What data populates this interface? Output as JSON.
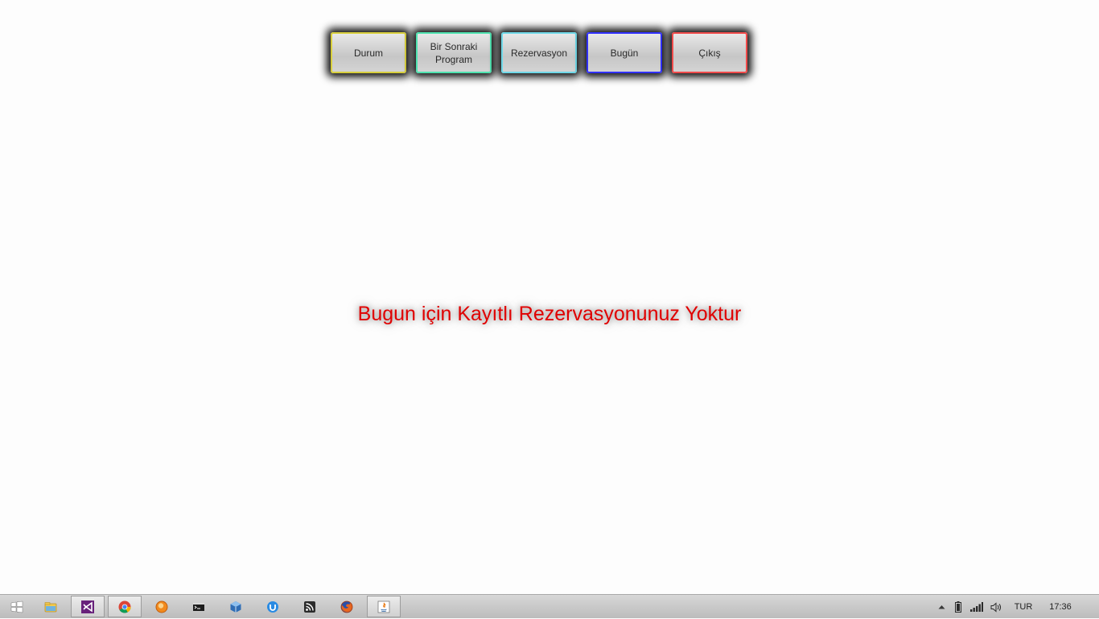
{
  "nav": {
    "buttons": [
      {
        "id": "durum",
        "label": "Durum",
        "border_color": "#d8cf3c"
      },
      {
        "id": "bir-sonraki-program",
        "label": "Bir Sonraki\nProgram",
        "border_color": "#4fe3b0"
      },
      {
        "id": "rezervasyon",
        "label": "Rezervasyon",
        "border_color": "#6fd8e8"
      },
      {
        "id": "bugun",
        "label": "Bugün",
        "border_color": "#3030ff"
      },
      {
        "id": "cikis",
        "label": "Çıkış",
        "border_color": "#f04a4a"
      }
    ]
  },
  "main": {
    "message": "Bugun için Kayıtlı Rezervasyonunuz Yoktur",
    "message_color": "#e00000"
  },
  "taskbar": {
    "items": [
      {
        "icon": "windows-start-icon"
      },
      {
        "icon": "file-explorer-icon"
      },
      {
        "icon": "visual-studio-icon",
        "active": true
      },
      {
        "icon": "chrome-icon",
        "active": true
      },
      {
        "icon": "browser-orange-icon"
      },
      {
        "icon": "command-prompt-icon"
      },
      {
        "icon": "virtualbox-icon"
      },
      {
        "icon": "torrent-icon"
      },
      {
        "icon": "rss-reader-icon"
      },
      {
        "icon": "firefox-icon"
      },
      {
        "icon": "java-app-icon",
        "active": true
      }
    ],
    "tray": {
      "language": "TUR",
      "time": "17:36"
    }
  }
}
